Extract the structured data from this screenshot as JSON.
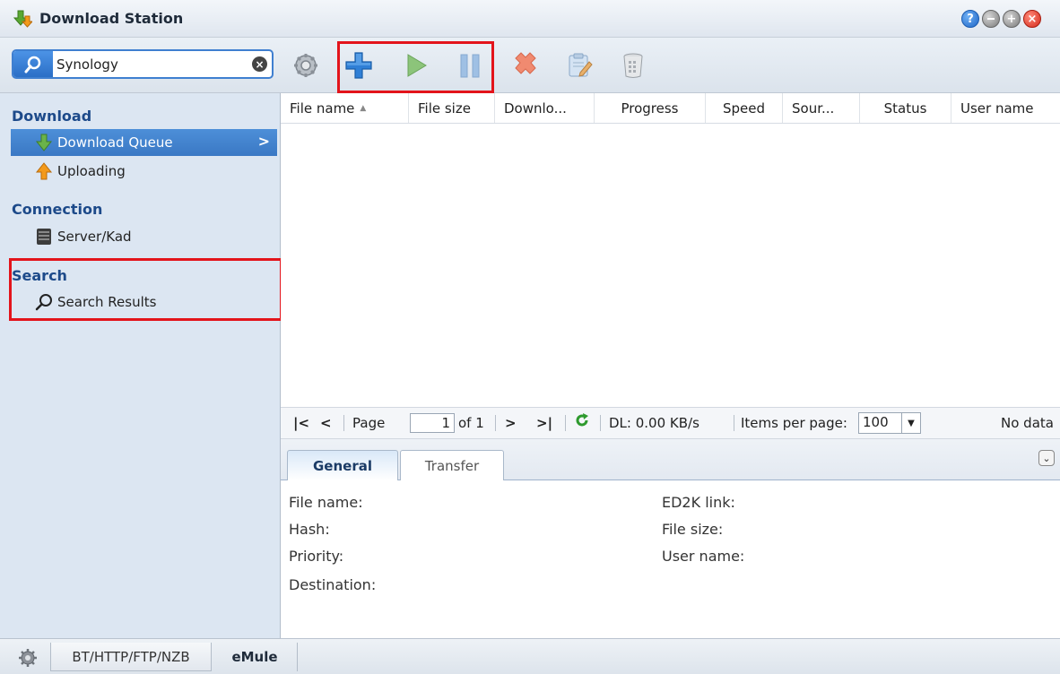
{
  "window": {
    "title": "Download Station"
  },
  "search": {
    "value": "Synology"
  },
  "sidebar": {
    "sections": [
      {
        "title": "Download",
        "items": [
          {
            "label": "Download Queue",
            "active": true
          },
          {
            "label": "Uploading"
          }
        ]
      },
      {
        "title": "Connection",
        "items": [
          {
            "label": "Server/Kad"
          }
        ]
      },
      {
        "title": "Search",
        "items": [
          {
            "label": "Search Results"
          }
        ]
      }
    ]
  },
  "grid": {
    "columns": [
      "File name",
      "File size",
      "Downlo...",
      "Progress",
      "Speed",
      "Sour...",
      "Status",
      "User name"
    ]
  },
  "pager": {
    "page_label": "Page",
    "page_value": "1",
    "of_label": "of 1",
    "dl_speed": "DL: 0.00 KB/s",
    "items_label": "Items per page:",
    "items_value": "100",
    "no_data": "No data"
  },
  "details": {
    "tabs": [
      "General",
      "Transfer"
    ],
    "left_fields": [
      "File name:",
      "Hash:",
      "Priority:",
      "Destination:"
    ],
    "right_fields": [
      "ED2K link:",
      "File size:",
      "User name:"
    ]
  },
  "statusbar": {
    "tabs": [
      "BT/HTTP/FTP/NZB",
      "eMule"
    ]
  },
  "colors": {
    "accent": "#3a78c4",
    "highlight": "#e3141b",
    "sidebar_bg": "#dce6f2"
  }
}
